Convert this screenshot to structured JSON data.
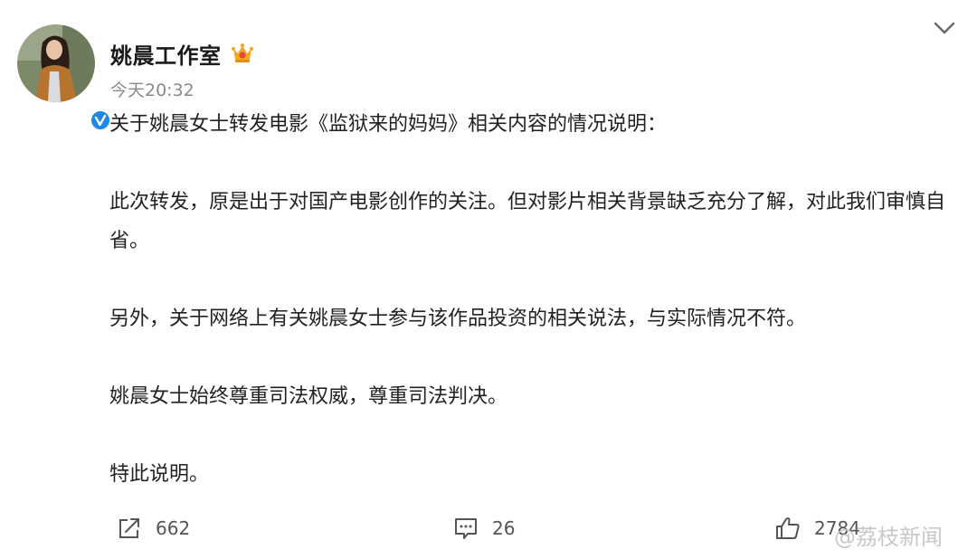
{
  "post": {
    "author": "姚晨工作室",
    "timestamp": "今天20:32",
    "paragraphs": [
      "关于姚晨女士转发电影《监狱来的妈妈》相关内容的情况说明：",
      "此次转发，原是出于对国产电影创作的关注。但对影片相关背景缺乏充分了解，对此我们审慎自省。",
      "另外，关于网络上有关姚晨女士参与该作品投资的相关说法，与实际情况不符。",
      "姚晨女士始终尊重司法权威，尊重司法判决。",
      "特此说明。"
    ]
  },
  "actions": {
    "repost_count": "662",
    "comment_count": "26",
    "like_count": "2784"
  },
  "watermark": "@荔枝新闻",
  "icons": {
    "repost": "repost-icon",
    "comment": "comment-icon",
    "like": "thumbs-up-icon",
    "menu": "chevron-down-icon",
    "verified": "verified-badge-icon",
    "member": "crown-icon"
  },
  "colors": {
    "verified_blue": "#1e88e5",
    "crown_gold": "#f5a623",
    "crown_red": "#e8453c",
    "muted_text": "#8a8a8a"
  }
}
